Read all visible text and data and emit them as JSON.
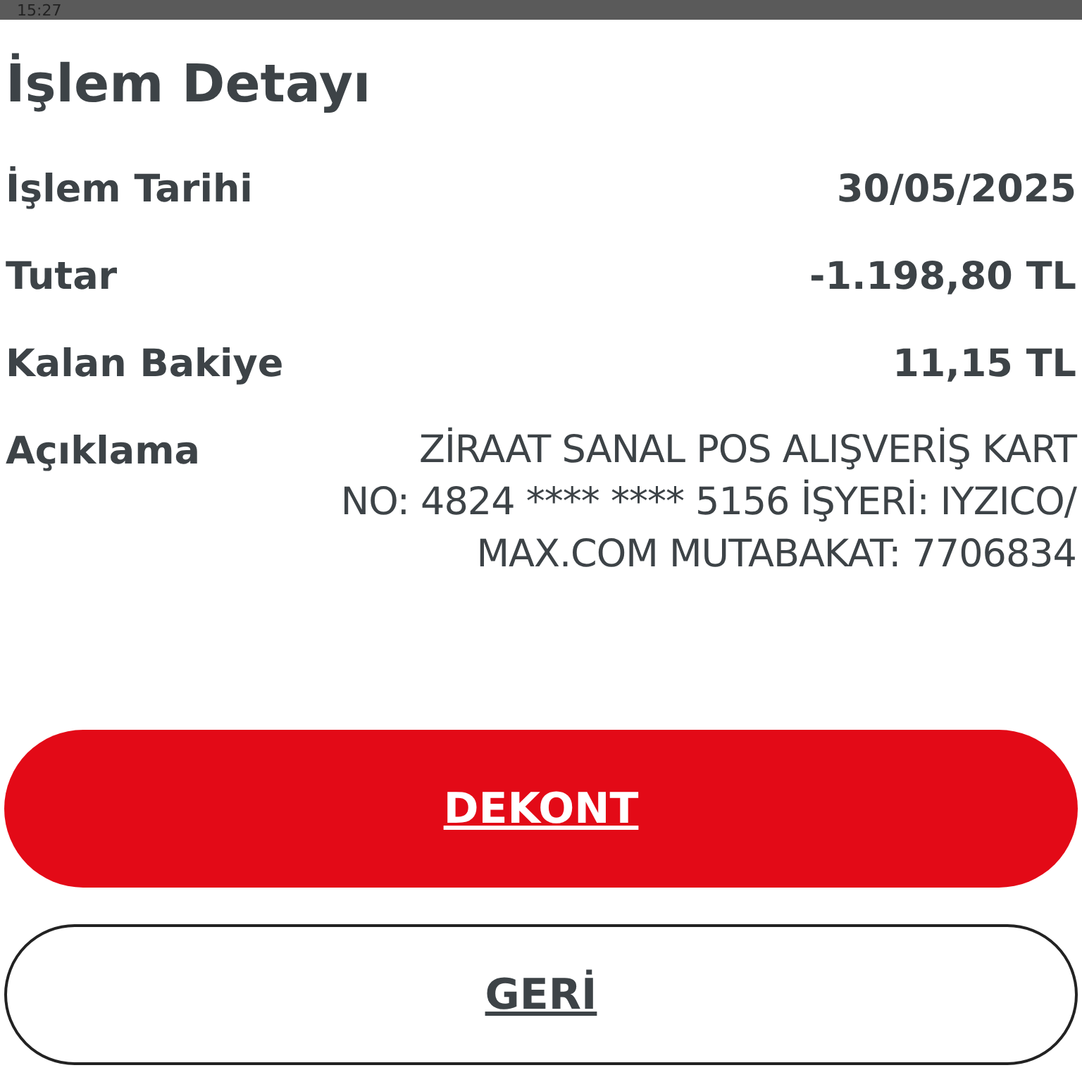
{
  "status_bar": {
    "time": "15:27"
  },
  "title": "İşlem Detayı",
  "details": [
    {
      "label": "İşlem Tarihi",
      "value": "30/05/2025"
    },
    {
      "label": "Tutar",
      "value": "-1.198,80 TL"
    },
    {
      "label": "Kalan Bakiye",
      "value": "11,15 TL"
    }
  ],
  "description": {
    "label": "Açıklama",
    "lines": [
      "ZİRAAT SANAL POS ALIŞVERİŞ KART",
      "NO: 4824 **** **** 5156 İŞYERİ: IYZICO/",
      "MAX.COM  MUTABAKAT: 7706834"
    ]
  },
  "buttons": [
    {
      "label": "DEKONT",
      "kind": "primary"
    },
    {
      "label": "GERİ",
      "kind": "secondary"
    }
  ]
}
